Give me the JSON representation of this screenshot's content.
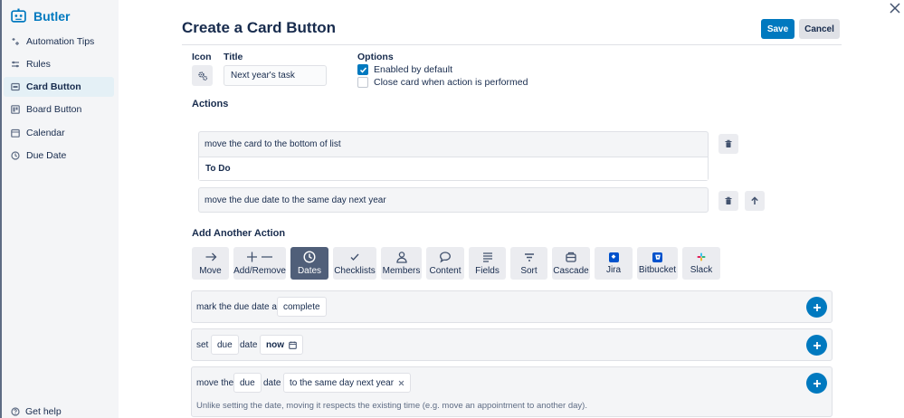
{
  "sidebar": {
    "brand": "Butler",
    "items": [
      {
        "label": "Automation Tips",
        "icon": "sparkle-icon"
      },
      {
        "label": "Rules",
        "icon": "sliders-icon"
      },
      {
        "label": "Card Button",
        "icon": "card-icon",
        "active": true
      },
      {
        "label": "Board Button",
        "icon": "board-icon"
      },
      {
        "label": "Calendar",
        "icon": "calendar-icon"
      },
      {
        "label": "Due Date",
        "icon": "clock-icon"
      }
    ],
    "help": "Get help"
  },
  "header": {
    "title": "Create a Card Button",
    "save_label": "Save",
    "cancel_label": "Cancel"
  },
  "form": {
    "icon_label": "Icon",
    "title_label": "Title",
    "title_value": "Next year's task",
    "options_label": "Options",
    "options": [
      {
        "label": "Enabled by default",
        "checked": true
      },
      {
        "label": "Close card when action is performed",
        "checked": false
      }
    ]
  },
  "actions": {
    "heading": "Actions",
    "items": [
      {
        "text": "move the card to the bottom of list",
        "sub": "To Do"
      },
      {
        "text": "move the due date to the same day next year"
      }
    ]
  },
  "add_action": {
    "heading": "Add Another Action",
    "tabs": [
      {
        "label": "Move",
        "icon": "arrow-right-icon"
      },
      {
        "label": "Add/Remove",
        "icon": "plus-minus-icon"
      },
      {
        "label": "Dates",
        "icon": "clock-icon",
        "active": true
      },
      {
        "label": "Checklists",
        "icon": "check-icon"
      },
      {
        "label": "Members",
        "icon": "person-icon"
      },
      {
        "label": "Content",
        "icon": "speech-bubble-icon"
      },
      {
        "label": "Fields",
        "icon": "lines-icon"
      },
      {
        "label": "Sort",
        "icon": "sort-icon"
      },
      {
        "label": "Cascade",
        "icon": "cascade-icon"
      },
      {
        "label": "Jira",
        "icon": "jira-logo-icon"
      },
      {
        "label": "Bitbucket",
        "icon": "bitbucket-logo-icon"
      },
      {
        "label": "Slack",
        "icon": "slack-logo-icon"
      }
    ],
    "triggers": [
      {
        "prefix": "mark the due date as",
        "pill": "complete"
      },
      {
        "prefix": "set",
        "pill1": "due",
        "mid": "date",
        "pill2": "now"
      },
      {
        "prefix": "move the",
        "pill1": "due",
        "mid": "date",
        "pill2": "to the same day next year",
        "hint": "Unlike setting the date, moving it respects the existing time (e.g. move an appointment to another day)."
      }
    ]
  },
  "colors": {
    "accent": "#0079bf",
    "active_tab": "#505f79",
    "sidebar_bg": "#f4f5f7"
  }
}
